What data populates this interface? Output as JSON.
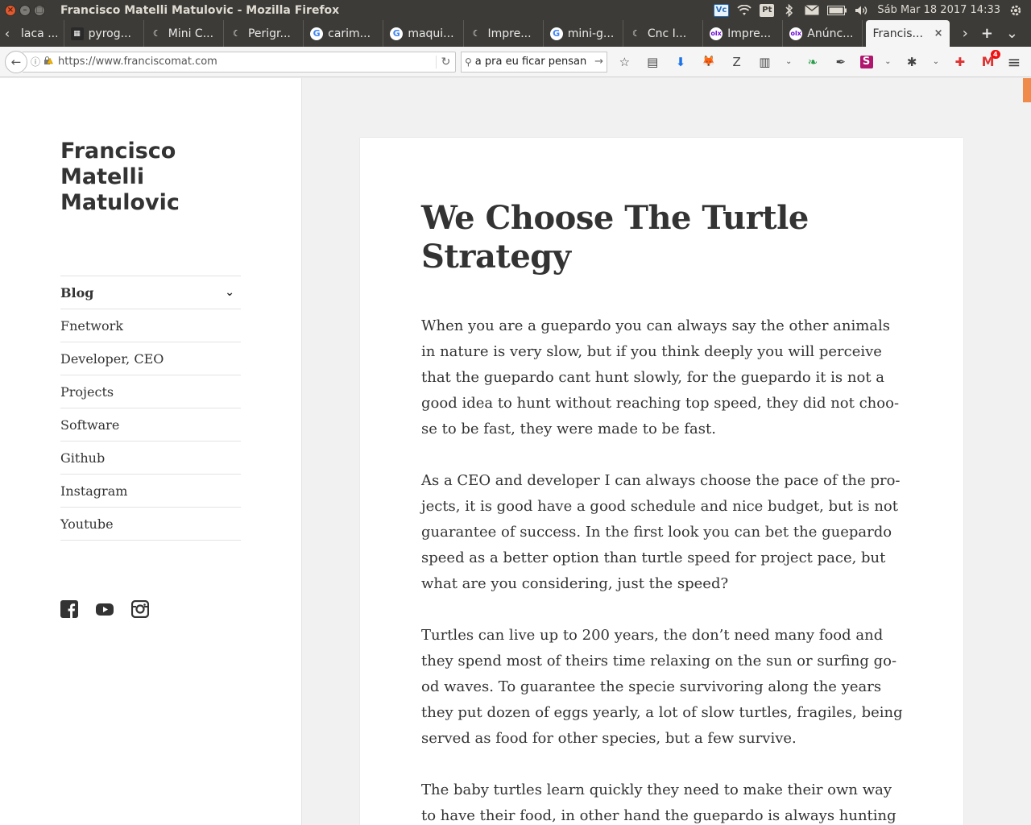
{
  "os": {
    "window_title": "Francisco Matelli Matulovic - Mozilla Firefox",
    "tray_icons": [
      "vc-icon",
      "wifi-icon",
      "pt-keyboard-icon",
      "bluetooth-icon",
      "mail-icon",
      "battery-icon",
      "volume-icon"
    ],
    "tray_labels": {
      "vc": "Vc",
      "pt": "Pt"
    },
    "clock": "Sáb Mar 18 2017 14:33",
    "window_buttons": {
      "close": "×",
      "minimize": "–",
      "maximize": "□"
    }
  },
  "browser": {
    "tabs": [
      {
        "label": "laca ...",
        "favicon": "page"
      },
      {
        "label": "pyrog...",
        "favicon": "pyrog"
      },
      {
        "label": "Mini C...",
        "favicon": "moon"
      },
      {
        "label": "Perigr...",
        "favicon": "moon"
      },
      {
        "label": "carim...",
        "favicon": "google"
      },
      {
        "label": "maqui...",
        "favicon": "google"
      },
      {
        "label": "Impre...",
        "favicon": "moon"
      },
      {
        "label": "mini-g...",
        "favicon": "google"
      },
      {
        "label": "Cnc I...",
        "favicon": "moon"
      },
      {
        "label": "Impre...",
        "favicon": "olx"
      },
      {
        "label": "Anúnc...",
        "favicon": "olx"
      },
      {
        "label": "Francis...",
        "favicon": "none",
        "active": true
      }
    ],
    "tab_close_glyph": "×",
    "tab_controls": {
      "scroll_left": "‹",
      "scroll_right": "›",
      "new_tab": "+",
      "list_all": "⌄"
    },
    "favicon_text": {
      "google": "G",
      "moon": "☾",
      "olx": "olx",
      "pyrog": "▦",
      "page": ""
    },
    "url": "https://www.franciscomat.com",
    "search_text": "a pra eu ficar pensan",
    "nav_glyphs": {
      "back": "←",
      "info": "ⓘ",
      "lock": "🔒",
      "reload": "↻",
      "search": "⚲",
      "go": "→"
    },
    "toolbar_icons": [
      {
        "name": "bookmark-star-icon",
        "glyph": "☆"
      },
      {
        "name": "reading-list-icon",
        "glyph": "▤"
      },
      {
        "name": "downloads-icon",
        "glyph": "⬇"
      },
      {
        "name": "fox-addon-icon",
        "glyph": "🦊"
      },
      {
        "name": "zotero-icon",
        "glyph": "Z"
      },
      {
        "name": "clipboard-addon-icon",
        "glyph": "▥"
      },
      {
        "name": "dropdown-1-icon",
        "glyph": "⌄"
      },
      {
        "name": "leaf-addon-icon",
        "glyph": "❧"
      },
      {
        "name": "feather-addon-icon",
        "glyph": "✒"
      },
      {
        "name": "s-addon-icon",
        "glyph": "S"
      },
      {
        "name": "dropdown-2-icon",
        "glyph": "⌄"
      },
      {
        "name": "bug-addon-icon",
        "glyph": "✱"
      },
      {
        "name": "dropdown-3-icon",
        "glyph": "⌄"
      },
      {
        "name": "redcross-addon-icon",
        "glyph": "✚"
      },
      {
        "name": "gmail-icon",
        "glyph": "M",
        "badge": "4"
      }
    ],
    "menu_glyph": "≡"
  },
  "site": {
    "title_lines": [
      "Francisco",
      "Matelli",
      "Matulovic"
    ],
    "menu": [
      {
        "label": "Blog",
        "has_children": true,
        "chevron": "⌄"
      },
      {
        "label": "Fnetwork"
      },
      {
        "label": "Developer, CEO"
      },
      {
        "label": "Projects"
      },
      {
        "label": "Software"
      },
      {
        "label": "Github"
      },
      {
        "label": "Instagram"
      },
      {
        "label": "Youtube"
      }
    ],
    "social": [
      "facebook-icon",
      "youtube-icon",
      "instagram-icon"
    ]
  },
  "article": {
    "title_lines": [
      "We Choose The Turtle",
      "Strategy"
    ],
    "paragraphs": [
      [
        "When you are a guepardo you can always say the other animals",
        "in nature is very slow, but if you think deeply you will perceive",
        "that the guepardo cant hunt slowly, for the guepardo it is not a",
        "good idea to hunt without reaching top speed, they did not choo-",
        "se to be fast, they were made to be fast."
      ],
      [
        "As a CEO and developer I can always choose the pace of the pro-",
        "jects, it is good have a good schedule and nice budget, but is not",
        "guarantee of success. In the first look you can bet the guepardo",
        "speed as a better option than turtle speed for project pace, but",
        "what are you considering, just the speed?"
      ],
      [
        "Turtles can live up to 200 years, the don’t need many food and",
        "they spend most of theirs time relaxing on the sun or surfing go-",
        "od waves. To guarantee the specie survivoring along the years",
        "they put dozen of eggs yearly, a lot of slow turtles, fragiles, being",
        "served as food for other species, but a few survive."
      ],
      [
        "The baby turtles learn quickly they need to make their own way",
        "to have their food, in other hand the guepardo is always hunting"
      ]
    ]
  },
  "colors": {
    "accent": "#f08a4b",
    "titlebar": "#3c3b37",
    "text": "#333333"
  }
}
